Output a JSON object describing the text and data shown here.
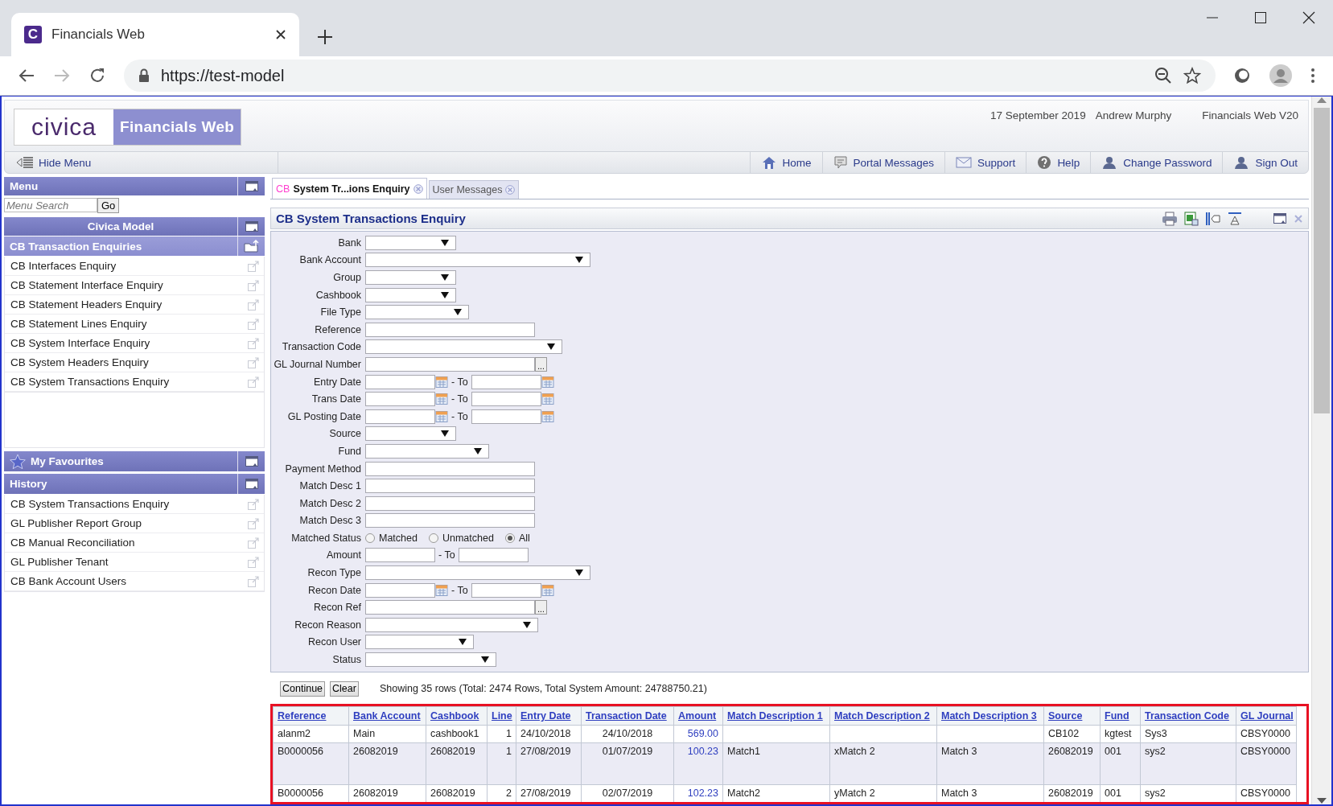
{
  "browser": {
    "tab_title": "Financials Web",
    "favicon_letter": "C",
    "url": "https://test-model"
  },
  "header": {
    "logo": "civica",
    "product": "Financials Web",
    "date": "17 September 2019",
    "user": "Andrew Murphy",
    "version": "Financials Web V20"
  },
  "nav": {
    "hide_menu": "Hide Menu",
    "links": [
      {
        "kind": "home",
        "label": "Home"
      },
      {
        "kind": "messages",
        "label": "Portal Messages"
      },
      {
        "kind": "support",
        "label": "Support"
      },
      {
        "kind": "help",
        "label": "Help"
      },
      {
        "kind": "user",
        "label": "Change Password"
      },
      {
        "kind": "user",
        "label": "Sign Out"
      }
    ]
  },
  "sidebar": {
    "menu_title": "Menu",
    "search_placeholder": "Menu Search",
    "go": "Go",
    "model": "Civica Model",
    "section": "CB Transaction Enquiries",
    "items": [
      "CB Interfaces Enquiry",
      "CB Statement Interface Enquiry",
      "CB Statement Headers Enquiry",
      "CB Statement Lines Enquiry",
      "CB System Interface Enquiry",
      "CB System Headers Enquiry",
      "CB System Transactions Enquiry"
    ],
    "favourites": "My Favourites",
    "history_title": "History",
    "history_items": [
      "CB System Transactions Enquiry",
      "GL Publisher Report Group",
      "CB Manual Reconciliation",
      "GL Publisher Tenant",
      "CB Bank Account Users"
    ]
  },
  "tabs": [
    {
      "prefix": "CB",
      "label": "System Tr...ions Enquiry",
      "selected": true
    },
    {
      "label": "User Messages",
      "selected": false
    }
  ],
  "form": {
    "title": "CB System Transactions Enquiry",
    "fields": [
      {
        "kind": "select",
        "label": "Bank"
      },
      {
        "kind": "select",
        "label": "Bank Account"
      },
      {
        "kind": "select",
        "label": "Group"
      },
      {
        "kind": "select",
        "label": "Cashbook"
      },
      {
        "kind": "select",
        "label": "File Type"
      },
      {
        "kind": "text",
        "label": "Reference"
      },
      {
        "kind": "select",
        "label": "Transaction Code"
      },
      {
        "kind": "lookup",
        "label": "GL Journal Number",
        "button": "..."
      },
      {
        "kind": "daterange",
        "label": "Entry Date",
        "to": "- To"
      },
      {
        "kind": "daterange",
        "label": "Trans Date",
        "to": "- To"
      },
      {
        "kind": "daterange",
        "label": "GL Posting Date",
        "to": "- To"
      },
      {
        "kind": "select",
        "label": "Source"
      },
      {
        "kind": "select",
        "label": "Fund"
      },
      {
        "kind": "text",
        "label": "Payment Method"
      },
      {
        "kind": "text",
        "label": "Match Desc 1"
      },
      {
        "kind": "text",
        "label": "Match Desc 2"
      },
      {
        "kind": "text",
        "label": "Match Desc 3"
      },
      {
        "kind": "radio",
        "label": "Matched Status",
        "options": [
          {
            "label": "Matched",
            "selected": false
          },
          {
            "label": "Unmatched",
            "selected": false
          },
          {
            "label": "All",
            "selected": true
          }
        ]
      },
      {
        "kind": "range",
        "label": "Amount",
        "to": "- To"
      },
      {
        "kind": "select",
        "label": "Recon Type"
      },
      {
        "kind": "daterange",
        "label": "Recon Date",
        "to": "- To"
      },
      {
        "kind": "lookup",
        "label": "Recon Ref",
        "button": "..."
      },
      {
        "kind": "select",
        "label": "Recon Reason"
      },
      {
        "kind": "select",
        "label": "Recon User"
      },
      {
        "kind": "select",
        "label": "Status"
      }
    ]
  },
  "actions": {
    "buttons": [
      "Continue",
      "Clear"
    ],
    "summary": "Showing 35 rows (Total: 2474 Rows, Total System Amount: 24788750.21)"
  },
  "table": {
    "columns": [
      "Reference",
      "Bank Account",
      "Cashbook",
      "Line",
      "Entry Date",
      "Transaction Date",
      "Amount",
      "Match Description 1",
      "Match Description 2",
      "Match Description 3",
      "Source",
      "Fund",
      "Transaction Code",
      "GL Journal"
    ],
    "rows": [
      [
        "alanm2",
        "Main",
        "cashbook1",
        "1",
        "24/10/2018",
        "24/10/2018",
        "569.00",
        null,
        null,
        null,
        "CB102",
        "kgtest",
        "Sys3",
        "CBSY0000"
      ],
      [
        "B0000056",
        "26082019",
        "26082019",
        "1",
        "27/08/2019",
        "01/07/2019",
        "100.23",
        "Match1",
        "xMatch 2",
        "Match 3",
        "26082019",
        "001",
        "sys2",
        "CBSY0000"
      ],
      [
        "B0000056",
        "26082019",
        "26082019",
        "2",
        "27/08/2019",
        "02/07/2019",
        "102.23",
        "Match2",
        "yMatch 2",
        "Match 3",
        "26082019",
        "001",
        "sys2",
        "CBSY0000"
      ]
    ]
  }
}
